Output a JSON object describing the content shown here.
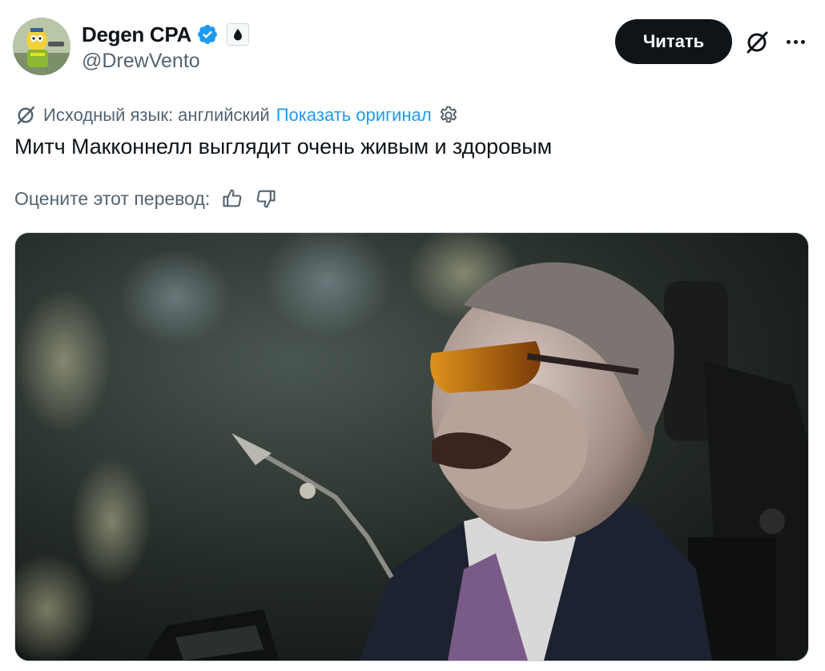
{
  "author": {
    "display_name": "Degen CPA",
    "handle": "@DrewVento",
    "verified_icon": "verified-badge-icon",
    "affiliation_icon": "drop-icon",
    "avatar_icon": "cartoon-avatar"
  },
  "actions": {
    "follow_label": "Читать",
    "grok_icon": "grok-icon",
    "more_icon": "more-icon"
  },
  "translation": {
    "source_label": "Исходный язык: английский",
    "show_original_label": "Показать оригинал",
    "rate_label": "Оцените этот перевод:",
    "translate_icon": "translate-icon",
    "settings_icon": "gear-icon",
    "thumbs_up_icon": "thumbs-up-icon",
    "thumbs_down_icon": "thumbs-down-icon"
  },
  "tweet": {
    "text": "Митч Макконнелл выглядит очень живым и здоровым"
  },
  "media": {
    "kind": "photo"
  },
  "colors": {
    "text": "#0f1419",
    "secondary": "#536471",
    "link": "#1d9bf0",
    "verified": "#1d9bf0",
    "button_bg": "#0f1419"
  }
}
